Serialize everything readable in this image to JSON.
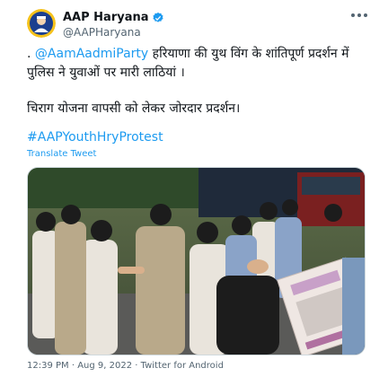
{
  "author": {
    "display_name": "AAP Haryana",
    "handle": "@AAPHaryana"
  },
  "tweet": {
    "prefix": ". ",
    "mention": "@AamAadmiParty",
    "line1_rest": " हरियाणा की युथ विंग के शांतिपूर्ण प्रदर्शन में पुलिस ने युवाओं पर मारी लाठियां ।",
    "line2": "चिराग योजना वापसी को लेकर जोरदार प्रदर्शन।",
    "hashtag": "#AAPYouthHryProtest",
    "translate_label": "Translate Tweet"
  },
  "meta": {
    "time": "12:39 PM",
    "separator": " · ",
    "date": "Aug 9, 2022",
    "source": "Twitter for Android"
  },
  "colors": {
    "accent": "#1d9bf0",
    "text": "#0f1419",
    "muted": "#536471"
  },
  "icons": [
    "verified-badge-icon",
    "more-options-icon"
  ]
}
